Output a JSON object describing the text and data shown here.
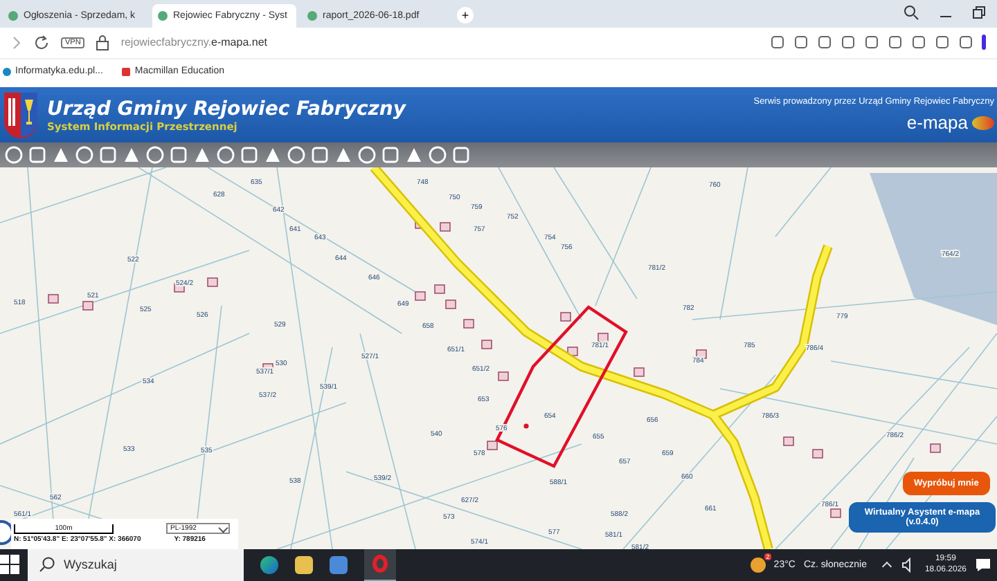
{
  "browser": {
    "tabs": [
      {
        "title": "Ogłoszenia - Sprzedam, k",
        "selected": false
      },
      {
        "title": "Rejowiec Fabryczny - Syst",
        "selected": true
      },
      {
        "title": "raport_2026-06-18.pdf",
        "selected": false
      }
    ],
    "new_tab": "+",
    "vpn": "VPN",
    "url_plain": "rejowiecfabryczny.",
    "url_domain": "e-mapa.net",
    "bookmarks": [
      "Informatyka.edu.pl...",
      "Macmillan Education"
    ]
  },
  "header": {
    "title": "Urząd Gminy Rejowiec Fabryczny",
    "subtitle": "System Informacji Przestrzennej",
    "service_note": "Serwis prowadzony przez Urząd Gminy Rejowiec Fabryczny",
    "brand": "e-mapa"
  },
  "map": {
    "parcels": [
      {
        "label": "635"
      },
      {
        "label": "748"
      },
      {
        "label": "750"
      },
      {
        "label": "759"
      },
      {
        "label": "752"
      },
      {
        "label": "757"
      },
      {
        "label": "754"
      },
      {
        "label": "756"
      },
      {
        "label": "760"
      },
      {
        "label": "781/2"
      },
      {
        "label": "781/1"
      },
      {
        "label": "782"
      },
      {
        "label": "764/2"
      },
      {
        "label": "779"
      },
      {
        "label": "785"
      },
      {
        "label": "784"
      },
      {
        "label": "786/4"
      },
      {
        "label": "786/3"
      },
      {
        "label": "628"
      },
      {
        "label": "642"
      },
      {
        "label": "641"
      },
      {
        "label": "643"
      },
      {
        "label": "644"
      },
      {
        "label": "646"
      },
      {
        "label": "649"
      },
      {
        "label": "658"
      },
      {
        "label": "651/1"
      },
      {
        "label": "651/2"
      },
      {
        "label": "653"
      },
      {
        "label": "654"
      },
      {
        "label": "655"
      },
      {
        "label": "656"
      },
      {
        "label": "657"
      },
      {
        "label": "576"
      },
      {
        "label": "578"
      },
      {
        "label": "588/1"
      },
      {
        "label": "588/2"
      },
      {
        "label": "581/1"
      },
      {
        "label": "581/2"
      },
      {
        "label": "577"
      },
      {
        "label": "659"
      },
      {
        "label": "660"
      },
      {
        "label": "661"
      },
      {
        "label": "786/1"
      },
      {
        "label": "786/2"
      },
      {
        "label": "522"
      },
      {
        "label": "521"
      },
      {
        "label": "518"
      },
      {
        "label": "524/2"
      },
      {
        "label": "525"
      },
      {
        "label": "526"
      },
      {
        "label": "527/1"
      },
      {
        "label": "529"
      },
      {
        "label": "530"
      },
      {
        "label": "537/1"
      },
      {
        "label": "537/2"
      },
      {
        "label": "539/1"
      },
      {
        "label": "534"
      },
      {
        "label": "533"
      },
      {
        "label": "535"
      },
      {
        "label": "538"
      },
      {
        "label": "539/2"
      },
      {
        "label": "562"
      },
      {
        "label": "561/1"
      },
      {
        "label": "627/2"
      },
      {
        "label": "573"
      },
      {
        "label": "574/1"
      },
      {
        "label": "540"
      }
    ],
    "scale": "100m",
    "projection": "PL-1992",
    "coords": "N: 51°05'43.8\"  E: 23°07'55.8\"  X: 366070",
    "coord_y": "Y: 789216",
    "try_button": "Wypróbuj mnie",
    "assistant": "Wirtualny Asystent e-mapa (v.0.4.0)"
  },
  "taskbar": {
    "search": "Wyszukaj",
    "weather_temp": "23°C",
    "weather_text": "Cz. słonecznie",
    "notification_count": "2",
    "time": "19:59",
    "date": "18.06.2026"
  }
}
